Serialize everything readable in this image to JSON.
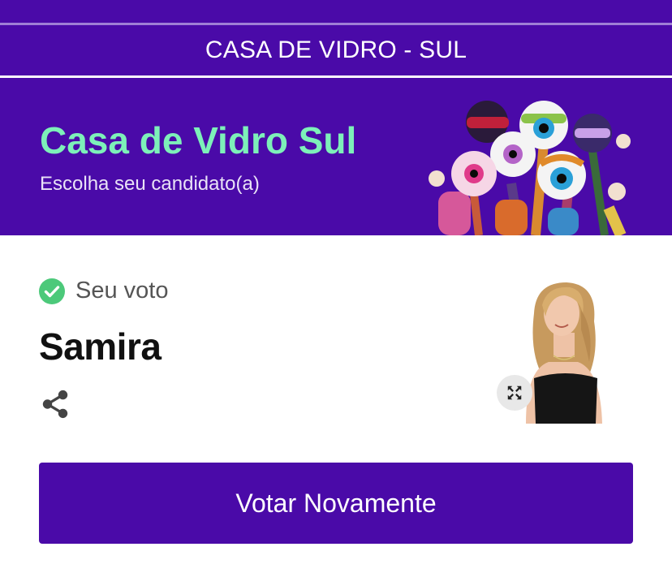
{
  "header": {
    "section_title": "CASA DE VIDRO - SUL"
  },
  "hero": {
    "title": "Casa de Vidro Sul",
    "subtitle": "Escolha seu candidato(a)"
  },
  "vote": {
    "status_label": "Seu voto",
    "candidate_name": "Samira"
  },
  "actions": {
    "vote_again_label": "Votar Novamente"
  },
  "colors": {
    "brand_purple": "#4a0aa8",
    "accent_green": "#7df0b9",
    "check_green": "#4cc97a"
  },
  "icons": {
    "status": "check-circle-icon",
    "share": "share-icon",
    "expand": "expand-icon"
  }
}
